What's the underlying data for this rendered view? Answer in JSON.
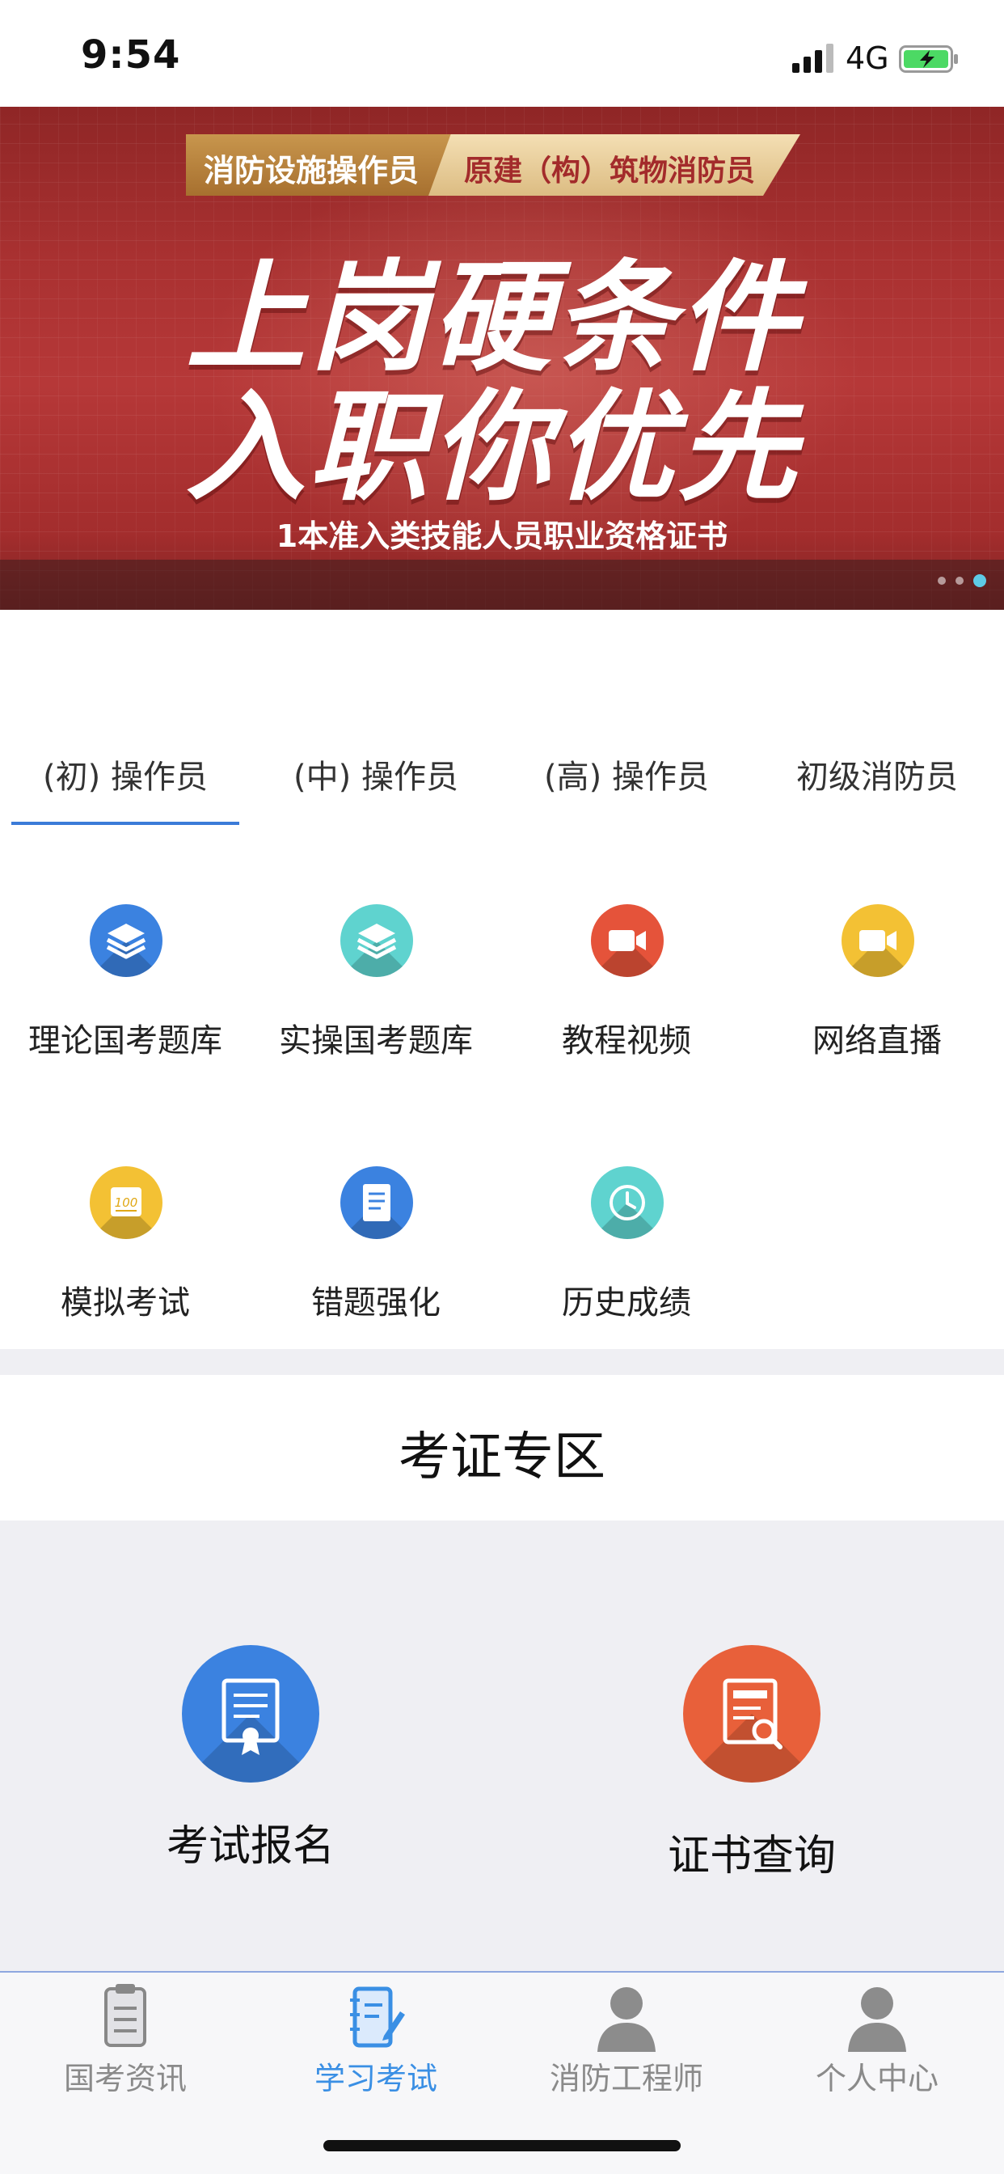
{
  "status_bar": {
    "time": "9:54",
    "network": "4G"
  },
  "banner": {
    "ribbon_left": "消防设施操作员",
    "ribbon_right": "原建（构）筑物消防员",
    "headline_line1": "上岗硬条件",
    "headline_line2": "入职你优先",
    "caption": "1本准入类技能人员职业资格证书",
    "slide_count": 3,
    "active_slide": 3
  },
  "tabs": [
    {
      "label": "(初) 操作员",
      "selected": true
    },
    {
      "label": "(中) 操作员",
      "selected": false
    },
    {
      "label": "(高) 操作员",
      "selected": false
    },
    {
      "label": "初级消防员",
      "selected": false
    }
  ],
  "features": [
    {
      "label": "理论国考题库",
      "icon": "layers-icon",
      "color": "#3b82e0"
    },
    {
      "label": "实操国考题库",
      "icon": "layers-icon",
      "color": "#5fd3cf"
    },
    {
      "label": "教程视频",
      "icon": "video-icon",
      "color": "#e5533a"
    },
    {
      "label": "网络直播",
      "icon": "video-icon",
      "color": "#f3c134"
    },
    {
      "label": "模拟考试",
      "icon": "score-100-icon",
      "color": "#f3c134"
    },
    {
      "label": "错题强化",
      "icon": "notebook-icon",
      "color": "#3b82e0"
    },
    {
      "label": "历史成绩",
      "icon": "clock-icon",
      "color": "#5fd3cf"
    }
  ],
  "zone": {
    "title": "考证专区",
    "items": [
      {
        "label": "考试报名",
        "icon": "certificate-icon",
        "color": "#3b82e0"
      },
      {
        "label": "证书查询",
        "icon": "document-search-icon",
        "color": "#e8603a"
      }
    ]
  },
  "bottom_nav": [
    {
      "label": "国考资讯",
      "icon": "clipboard-icon",
      "active": false
    },
    {
      "label": "学习考试",
      "icon": "notebook-pen-icon",
      "active": true
    },
    {
      "label": "消防工程师",
      "icon": "person-icon",
      "active": false
    },
    {
      "label": "个人中心",
      "icon": "person-icon",
      "active": false
    }
  ],
  "colors": {
    "accent": "#3a8fe4",
    "tab_underline": "#3b7bd8",
    "banner_red": "#a93131"
  }
}
